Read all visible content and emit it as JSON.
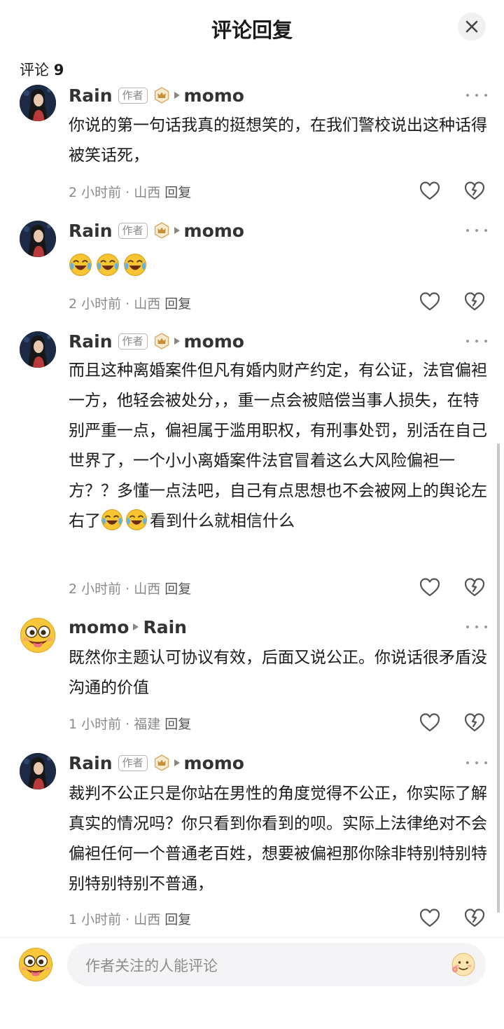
{
  "header": {
    "title": "评论回复",
    "close_icon": "close-icon"
  },
  "comment_count": {
    "label": "评论",
    "value": "9"
  },
  "comments": [
    {
      "author": "Rain",
      "author_tag": "作者",
      "badge_icon": "crown-badge-icon",
      "reply_to": "momo",
      "text": "你说的第一句话我真的挺想笑的，在我们警校说出这种话得被笑话死，",
      "time": "2 小时前",
      "location": "山西",
      "reply_label": "回复"
    },
    {
      "author": "Rain",
      "author_tag": "作者",
      "badge_icon": "crown-badge-icon",
      "reply_to": "momo",
      "emojis": [
        "laugh-cry-emoji",
        "laugh-cry-emoji",
        "laugh-cry-emoji"
      ],
      "time": "2 小时前",
      "location": "山西",
      "reply_label": "回复"
    },
    {
      "author": "Rain",
      "author_tag": "作者",
      "badge_icon": "crown-badge-icon",
      "reply_to": "momo",
      "text_before": "而且这种离婚案件但凡有婚内财产约定，有公证，法官偏袒一方，他轻会被处分，，重一点会被赔偿当事人损失，在特别严重一点，偏袒属于滥用职权，有刑事处罚，别活在自己世界了，一个小小离婚案件法官冒着这么大风险偏袒一方？？多懂一点法吧，自己有点思想也不会被网上的舆论左右了",
      "text_after": "看到什么就相信什么",
      "time": "2 小时前",
      "location": "山西",
      "reply_label": "回复"
    },
    {
      "author": "momo",
      "reply_to": "Rain",
      "text": "既然你主题认可协议有效，后面又说公正。你说话很矛盾没沟通的价值",
      "time": "1 小时前",
      "location": "福建",
      "reply_label": "回复"
    },
    {
      "author": "Rain",
      "author_tag": "作者",
      "badge_icon": "crown-badge-icon",
      "reply_to": "momo",
      "text": "裁判不公正只是你站在男性的角度觉得不公正，你实际了解真实的情况吗？你只看到你看到的呗。实际上法律绝对不会偏袒任何一个普通老百姓，想要被偏袒那你除非特别特别特别特别特别不普通，",
      "time": "1 小时前",
      "location": "山西",
      "reply_label": "回复"
    }
  ],
  "footer": {
    "placeholder": "作者关注的人能评论"
  }
}
